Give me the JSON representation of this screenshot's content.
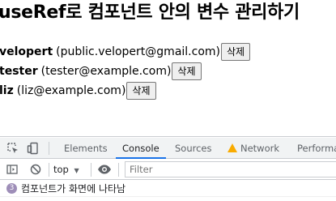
{
  "page": {
    "title": "useRef로 컴포넌트 안의 변수 관리하기",
    "users": [
      {
        "username": "velopert",
        "email": "(public.velopert@gmail.com)",
        "delete_label": "삭제"
      },
      {
        "username": "tester",
        "email": "(tester@example.com)",
        "delete_label": "삭제"
      },
      {
        "username": "liz",
        "email": "(liz@example.com)",
        "delete_label": "삭제"
      }
    ]
  },
  "devtools": {
    "tabs": [
      "Elements",
      "Console",
      "Sources",
      "Network",
      "Performa"
    ],
    "active_tab": "Console",
    "context": "top",
    "filter_placeholder": "Filter",
    "messages": [
      {
        "count": "3",
        "text": "컴포넌트가 화면에 나타남"
      }
    ]
  },
  "colors": {
    "accent": "#1a73e8",
    "warning": "#f9ab00",
    "badge": "#9e8eb8",
    "panel_bg": "#f1f3f4"
  },
  "icons": [
    "inspect-element-icon",
    "device-toolbar-icon",
    "warning-icon",
    "sidebar-toggle-icon",
    "clear-console-icon",
    "dropdown-arrow-icon",
    "eye-icon"
  ]
}
